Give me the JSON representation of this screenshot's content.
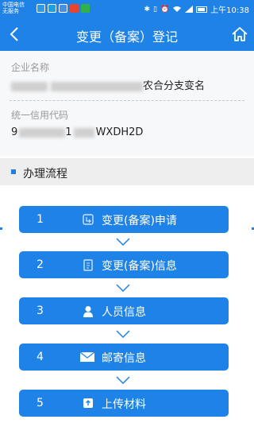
{
  "status_bar": {
    "carrier_line1": "中国电信",
    "carrier_line2": "无服务",
    "time": "上午10:38"
  },
  "header": {
    "title": "变更（备案）登记",
    "back_icon": "chevron-left-icon",
    "home_icon": "home-icon"
  },
  "company": {
    "name_label": "企业名称",
    "name_visible_suffix": "农合分支变名",
    "code_label": "统一信用代码",
    "code_visible_prefix": "9",
    "code_visible_mid": "1",
    "code_visible_suffix": "WXDH2D"
  },
  "section": {
    "title": "办理流程"
  },
  "steps": [
    {
      "number": "1",
      "label": "变更(备案)申请",
      "icon": "apply-icon"
    },
    {
      "number": "2",
      "label": "变更(备案)信息",
      "icon": "document-icon"
    },
    {
      "number": "3",
      "label": "人员信息",
      "icon": "person-icon"
    },
    {
      "number": "4",
      "label": "邮寄信息",
      "icon": "mail-icon"
    },
    {
      "number": "5",
      "label": "上传材料",
      "icon": "upload-icon"
    }
  ],
  "colors": {
    "primary": "#1f82e6",
    "info_bg": "#f7f8fa",
    "section_bg": "#eeeeee"
  }
}
